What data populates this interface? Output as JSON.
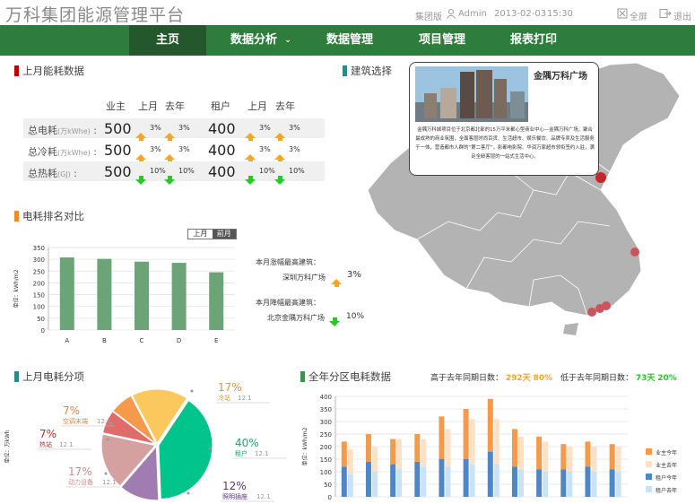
{
  "header": {
    "title": "万科集团能源管理平台",
    "version": "集团版",
    "user": "Admin",
    "date": "2013-02-03",
    "time": "15:30",
    "fullscreen": "全屏",
    "logout": "退出"
  },
  "nav": [
    {
      "label": "主页",
      "active": true
    },
    {
      "label": "数据分析",
      "dropdown": true
    },
    {
      "label": "数据管理"
    },
    {
      "label": "项目管理"
    },
    {
      "label": "报表打印"
    }
  ],
  "last_month": {
    "title": "上月能耗数据",
    "col_owner": "业主",
    "col_tenant": "租户",
    "col_last_month": "上月",
    "col_last_year": "去年",
    "rows": [
      {
        "label": "总电耗",
        "unit": "(万kWhe)",
        "owner": "500",
        "o_lm": "3%",
        "o_ly": "3%",
        "tenant": "400",
        "t_lm": "3%",
        "t_ly": "3%",
        "dir": "up"
      },
      {
        "label": "总冷耗",
        "unit": "(万kWhe)",
        "owner": "500",
        "o_lm": "3%",
        "o_ly": "3%",
        "tenant": "400",
        "t_lm": "3%",
        "t_ly": "3%",
        "dir": "up"
      },
      {
        "label": "总热耗",
        "unit": "(GJ)",
        "owner": "500",
        "o_lm": "10%",
        "o_ly": "10%",
        "tenant": "400",
        "t_lm": "10%",
        "t_ly": "10%",
        "dir": "down"
      }
    ]
  },
  "ranking": {
    "title": "电耗排名对比",
    "toggle": [
      "上月",
      "前月"
    ],
    "ylabel": "单位：kWh/m2",
    "rise_title": "本月涨幅最高建筑：",
    "rise_building": "深圳万科广场",
    "rise_value": "3%",
    "fall_title": "本月降幅最高建筑：",
    "fall_building": "北京金隅万科广场",
    "fall_value": "10%"
  },
  "building": {
    "title": "建筑选择",
    "popup_title": "金隅万科广场",
    "popup_text": "金隅万科城项目位于北京都北部的15万平米都心型商业中心—金隅万科广场，聚合最成熟的商业氛围，全面客层时尚百货、生活超市、娱乐餐饮、品牌专卖及生活服务于一体，营造都市人群的“第二客厅”，影都电影院、华润万家超市领衔签约入驻，满足全龄客层的一站式生活中心。"
  },
  "breakdown": {
    "title": "上月电耗分项",
    "ylabel": "单位：万kWh"
  },
  "annual": {
    "title": "全年分区电耗数据",
    "higher_label": "高于去年同期日数：",
    "higher_days": "292天",
    "higher_pct": "80%",
    "lower_label": "低于去年同期日数：",
    "lower_days": "73天",
    "lower_pct": "20%",
    "ylabel": "单位：kWh/m2"
  },
  "colors": {
    "nav": "#2e7d3c",
    "nav_active": "#24572b",
    "bar": "#6aa477",
    "up": "#f5a623",
    "down": "#26c926"
  },
  "chart_data": [
    {
      "type": "bar",
      "categories": [
        "A",
        "B",
        "C",
        "D",
        "E"
      ],
      "values": [
        308,
        302,
        290,
        285,
        245
      ],
      "ylim": [
        0,
        350
      ],
      "yticks": [
        0,
        50,
        100,
        150,
        200,
        250,
        300,
        350
      ],
      "title": "",
      "ylabel": "单位：kWh/m2",
      "grid": true
    },
    {
      "type": "pie",
      "slices": [
        {
          "name": "冷站",
          "value": 17,
          "label": "17%",
          "sub": "12.1",
          "color": "#fac85c"
        },
        {
          "name": "租户",
          "value": 40,
          "label": "40%",
          "sub": "12.1",
          "color": "#00c48c"
        },
        {
          "name": "照明插座",
          "value": 12,
          "label": "12%",
          "sub": "12.1",
          "color": "#a07cb0"
        },
        {
          "name": "动力设备",
          "value": 17,
          "label": "17%",
          "sub": "12.1",
          "color": "#d4a0a0"
        },
        {
          "name": "热站",
          "value": 7,
          "label": "7%",
          "sub": "12.1",
          "color": "#e06b6b"
        },
        {
          "name": "空调末端",
          "value": 7,
          "label": "7%",
          "sub": "12.1",
          "color": "#f59a4a"
        }
      ]
    },
    {
      "type": "bar",
      "ylim": [
        0,
        400
      ],
      "yticks": [
        0,
        50,
        100,
        150,
        200,
        250,
        300,
        350,
        400
      ],
      "ylabel": "单位：kWh/m2",
      "grid": true,
      "series": [
        {
          "name": "业主今年",
          "color": "#f59a4a",
          "values": [
            100,
            110,
            100,
            110,
            170,
            200,
            210,
            150,
            130,
            100,
            100,
            100
          ]
        },
        {
          "name": "业主去年",
          "color": "#fde1c4",
          "values": [
            100,
            100,
            120,
            110,
            150,
            180,
            180,
            130,
            120,
            100,
            100,
            100
          ]
        },
        {
          "name": "租户今年",
          "color": "#4f86c6",
          "values": [
            120,
            140,
            130,
            140,
            150,
            150,
            180,
            120,
            110,
            110,
            120,
            110
          ]
        },
        {
          "name": "租户去年",
          "color": "#c7e3f5",
          "values": [
            90,
            100,
            110,
            120,
            120,
            130,
            130,
            110,
            100,
            100,
            100,
            100
          ]
        }
      ]
    }
  ]
}
